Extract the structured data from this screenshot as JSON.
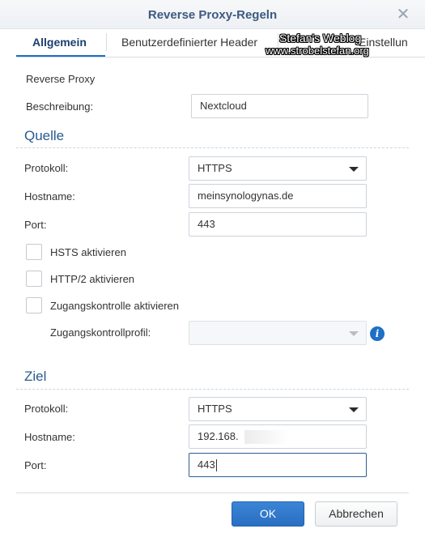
{
  "dialog": {
    "title": "Reverse Proxy-Regeln",
    "tabs": [
      {
        "label": "Allgemein"
      },
      {
        "label": "Benutzerdefinierter Header"
      },
      {
        "label": "Erweiterte Einstellungen",
        "visible_fragment": "Einstellun"
      }
    ]
  },
  "watermark": {
    "line1": "Stefan's Weblog",
    "line2": "www.strobelstefan.org"
  },
  "general": {
    "heading": "Reverse Proxy",
    "description_label": "Beschreibung:",
    "description_value": "Nextcloud"
  },
  "source": {
    "heading": "Quelle",
    "protocol_label": "Protokoll:",
    "protocol_value": "HTTPS",
    "hostname_label": "Hostname:",
    "hostname_value": "meinsynologynas.de",
    "port_label": "Port:",
    "port_value": "443",
    "hsts_label": "HSTS aktivieren",
    "http2_label": "HTTP/2 aktivieren",
    "access_control_label": "Zugangskontrolle aktivieren",
    "access_profile_label": "Zugangskontrollprofil:",
    "access_profile_value": "",
    "hsts_checked": false,
    "http2_checked": false,
    "access_control_checked": false
  },
  "target": {
    "heading": "Ziel",
    "protocol_label": "Protokoll:",
    "protocol_value": "HTTPS",
    "hostname_label": "Hostname:",
    "hostname_value": "192.168.",
    "port_label": "Port:",
    "port_value": "443"
  },
  "footer": {
    "ok_label": "OK",
    "cancel_label": "Abbrechen"
  },
  "colors": {
    "accent": "#1c6ec9",
    "title": "#3d5a80",
    "section": "#2a5a8c",
    "ok_button": "#2a6fc1"
  },
  "icons": {
    "close": "close-icon",
    "dropdown": "chevron-down-icon",
    "info": "info-icon"
  }
}
